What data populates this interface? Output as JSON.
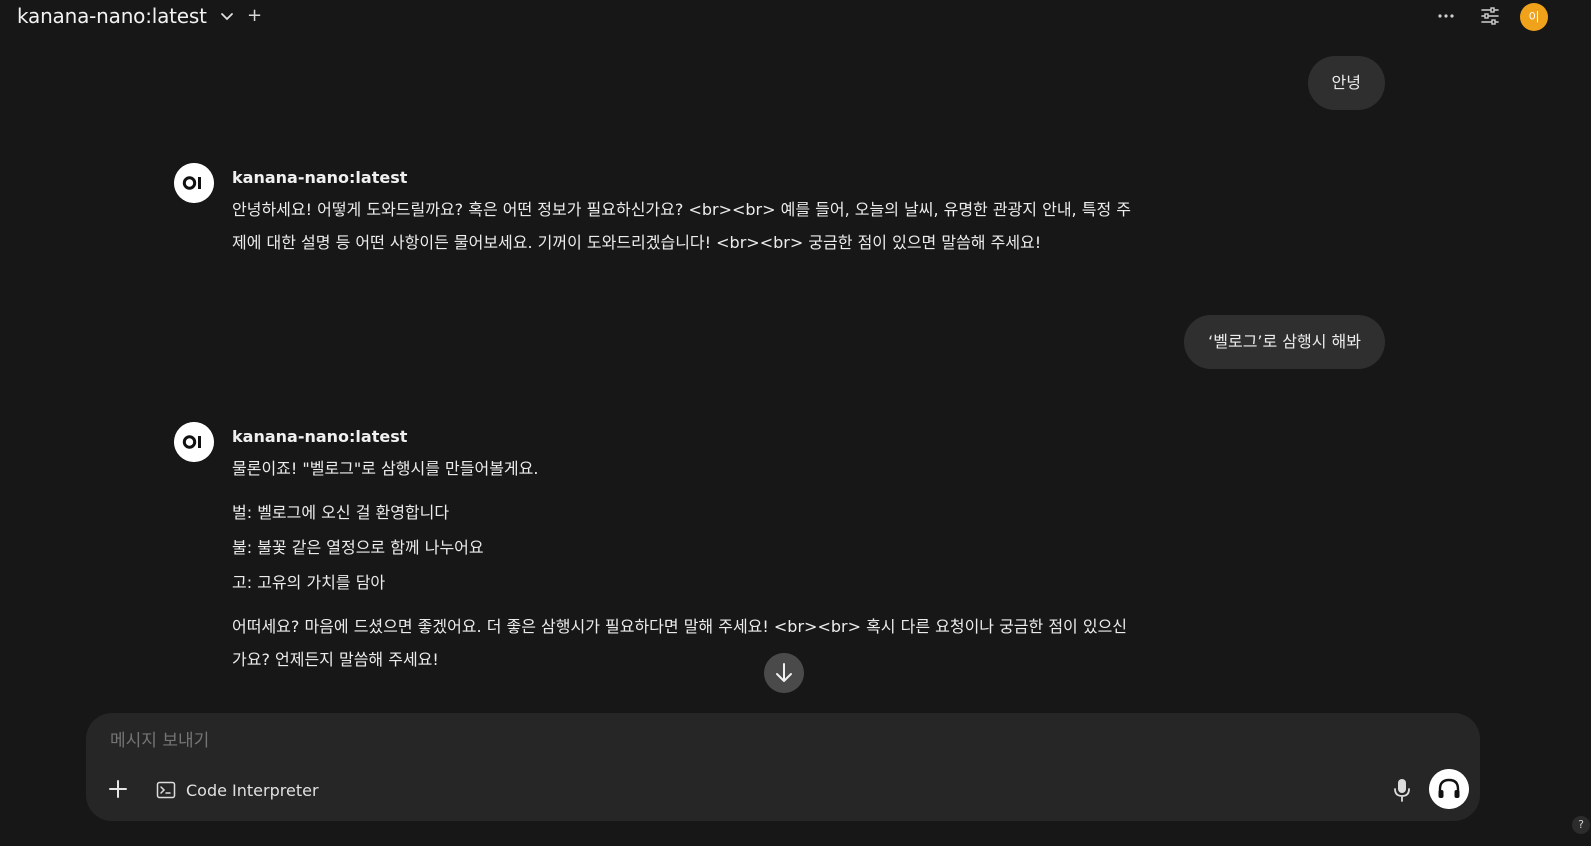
{
  "header": {
    "model_title": "kanana-nano:latest",
    "new_model_label": "+",
    "avatar_initial": "이",
    "avatar_color": "#f0a21b"
  },
  "messages": [
    {
      "role": "user",
      "text": "안녕"
    },
    {
      "role": "assistant",
      "model_name": "kanana-nano:latest",
      "lines": [
        "안녕하세요! 어떻게 도와드릴까요? 혹은 어떤 정보가 필요하신가요? <br><br> 예를 들어, 오늘의 날씨, 유명한 관광지 안내, 특정 주",
        "제에 대한 설명 등 어떤 사항이든 물어보세요. 기꺼이 도와드리겠습니다! <br><br> 궁금한 점이 있으면 말씀해 주세요!"
      ]
    },
    {
      "role": "user",
      "text": "‘벨로그’로 삼행시 해봐"
    },
    {
      "role": "assistant",
      "model_name": "kanana-nano:latest",
      "intro": "물론이죠! \"벨로그\"로 삼행시를 만들어볼게요.",
      "poem": [
        "벌: 벨로그에 오신 걸 환영합니다",
        "불: 불꽃 같은 열정으로 함께 나누어요",
        "고: 고유의 가치를 담아"
      ],
      "outro_lines": [
        "어떠세요? 마음에 드셨으면 좋겠어요. 더 좋은 삼행시가 필요하다면 말해 주세요! <br><br> 혹시 다른 요청이나 궁금한 점이 있으신",
        "가요? 언제든지 말씀해 주세요!"
      ]
    }
  ],
  "composer": {
    "placeholder": "메시지 보내기",
    "code_interpreter_label": "Code Interpreter"
  },
  "help_label": "?",
  "icons": {
    "more": "more-horizontal-icon",
    "controls": "sliders-icon",
    "scroll": "arrow-down-icon",
    "mic": "microphone-icon",
    "voice": "headphones-icon"
  }
}
